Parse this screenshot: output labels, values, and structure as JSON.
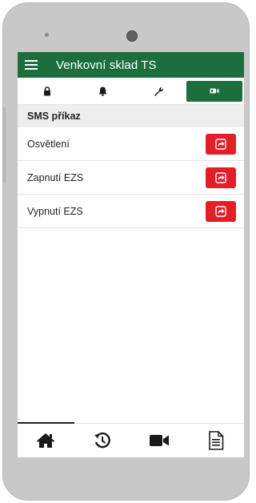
{
  "app": {
    "title": "Venkovní sklad TS"
  },
  "tabs": [
    {
      "icon": "lock-icon",
      "active": false
    },
    {
      "icon": "bell-icon",
      "active": false
    },
    {
      "icon": "wrench-icon",
      "active": false
    },
    {
      "icon": "sms-icon",
      "active": true
    }
  ],
  "section": {
    "title": "SMS příkaz"
  },
  "commands": [
    {
      "label": "Osvětlení",
      "action_icon": "send-icon"
    },
    {
      "label": "Zapnutí EZS",
      "action_icon": "send-icon"
    },
    {
      "label": "Vypnutí EZS",
      "action_icon": "send-icon"
    }
  ],
  "bottom_nav": [
    {
      "icon": "home-icon",
      "active": true
    },
    {
      "icon": "history-icon",
      "active": false
    },
    {
      "icon": "video-camera-icon",
      "active": false
    },
    {
      "icon": "document-icon",
      "active": false
    }
  ],
  "colors": {
    "primary": "#1c6e3d",
    "action": "#e41e26",
    "section_bg": "#eeeeee"
  }
}
